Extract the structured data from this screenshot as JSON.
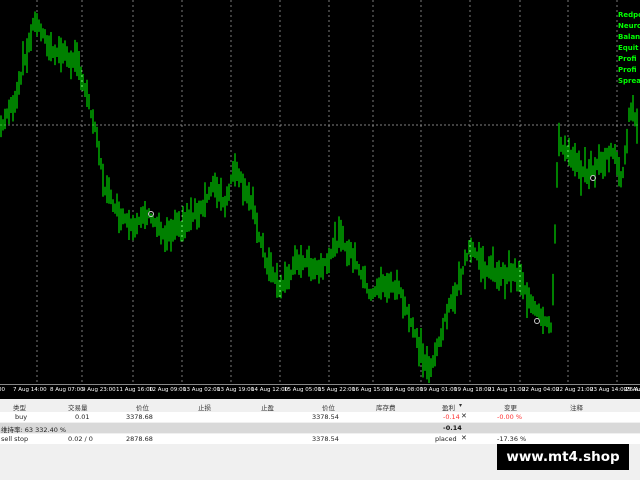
{
  "info_panel": [
    {
      "text": "Redpo"
    },
    {
      "text": "Neuro"
    },
    {
      "text": "Balan"
    },
    {
      "text": "Equit"
    },
    {
      "text": "Profi"
    },
    {
      "text": "Profi"
    },
    {
      "text": "Sprea"
    }
  ],
  "time_axis": [
    {
      "label": "00"
    },
    {
      "label": "7 Aug 14:00"
    },
    {
      "label": "8 Aug 07:00"
    },
    {
      "label": "9 Aug 23:00"
    },
    {
      "label": "11 Aug 16:00"
    },
    {
      "label": "12 Aug 09:00"
    },
    {
      "label": "13 Aug 02:00"
    },
    {
      "label": "13 Aug 19:00"
    },
    {
      "label": "14 Aug 12:00"
    },
    {
      "label": "15 Aug 05:00"
    },
    {
      "label": "15 Aug 22:00"
    },
    {
      "label": "16 Aug 15:00"
    },
    {
      "label": "18 Aug 08:00"
    },
    {
      "label": "19 Aug 01:00"
    },
    {
      "label": "19 Aug 18:00"
    },
    {
      "label": "21 Aug 11:00"
    },
    {
      "label": "22 Aug 04:00"
    },
    {
      "label": "22 Aug 21:00"
    },
    {
      "label": "23 Aug 14:00"
    },
    {
      "label": "25 Aug 07:00"
    },
    {
      "label": "26 Aug 00:"
    }
  ],
  "terminal": {
    "headers": {
      "type": "类型",
      "volume": "交易量",
      "price": "价位",
      "sl": "止损",
      "tp": "止盈",
      "cur_price": "价位",
      "swap": "库存费",
      "profit": "盈利",
      "change": "变更",
      "comment": "注释"
    },
    "order": {
      "type": "buy",
      "volume": "0.01",
      "price": "3378.68",
      "cur_price": "3378.54",
      "profit": "-0.14",
      "change": "-0.00 %"
    },
    "balance": {
      "text": "维持率: 63 332.40 %",
      "profit": "-0.14"
    },
    "pending": {
      "type": "sell stop",
      "volume": "0.02 / 0",
      "price": "2878.68",
      "cur_price": "3378.54",
      "status": "placed",
      "change": "-17.36 %"
    }
  },
  "watermark": "www.mt4.shop",
  "colors": {
    "candle": "#00ff00",
    "background": "#000000",
    "grid": "#ffffff",
    "negative": "#ff3333"
  },
  "icons": [
    "close-icon",
    "dropdown-arrow-icon",
    "trade-marker-icon"
  ]
}
